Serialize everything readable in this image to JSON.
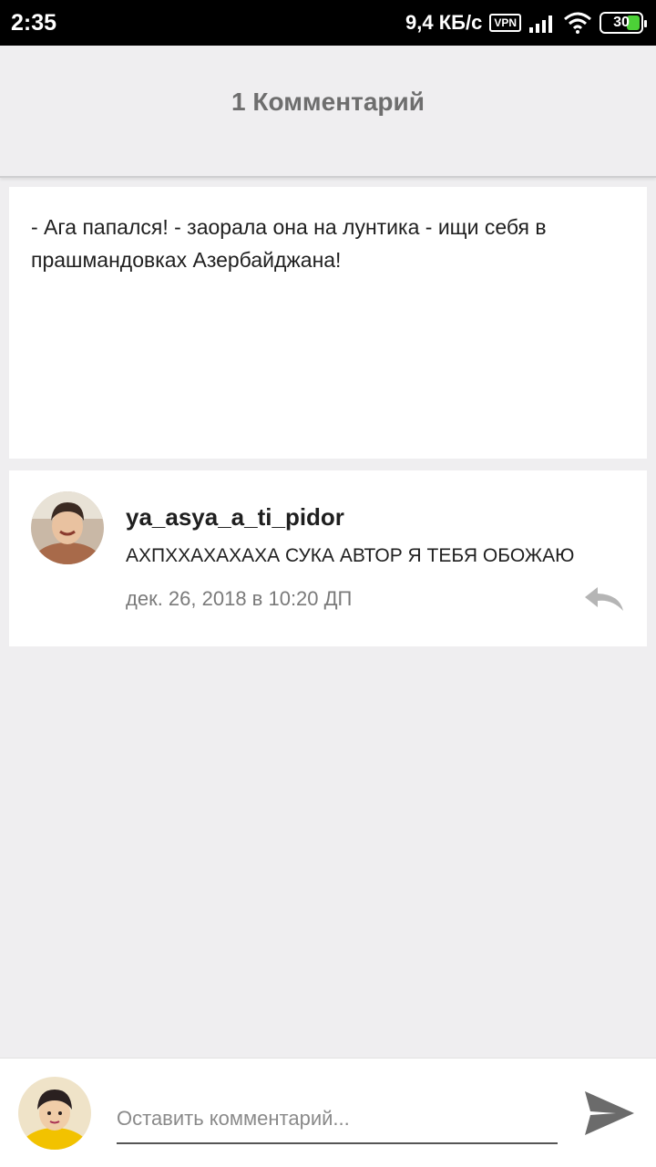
{
  "status_bar": {
    "time": "2:35",
    "net_speed": "9,4 КБ/с",
    "vpn": "VPN",
    "battery": "30",
    "battery_color": "#4cd137"
  },
  "header": {
    "title": "1 Комментарий"
  },
  "post": {
    "text": "- Ага папался! - заорала она на лунтика - ищи себя в прашмандовках Азербайджана!"
  },
  "comments": [
    {
      "author": "ya_asya_a_ti_pidor",
      "text": "АХПХХАХАХАХА СУКА АВТОР Я ТЕБЯ ОБОЖАЮ",
      "date": "дек. 26, 2018 в 10:20 ДП",
      "avatar_icon": "user-avatar-icon",
      "reply_icon": "reply-icon"
    }
  ],
  "compose": {
    "placeholder": "Оставить комментарий...",
    "value": "",
    "send_icon": "send-icon",
    "avatar_icon": "current-user-avatar-icon"
  }
}
